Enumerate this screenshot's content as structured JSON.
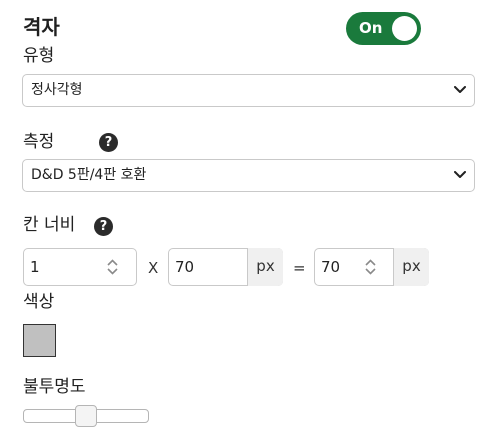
{
  "grid": {
    "title": "격자",
    "toggle_label": "On",
    "type_label": "유형",
    "type_value": "정사각형",
    "measure_label": "측정",
    "measure_help": "?",
    "measure_value": "D&D 5판/4판 호환",
    "cell_width_label": "칸 너비",
    "cell_width_help": "?",
    "cell_count_value": "1",
    "times_symbol": "X",
    "cell_px_value": "70",
    "cell_px_unit": "px",
    "equals_symbol": "=",
    "total_px_value": "70",
    "total_px_unit": "px",
    "color_label": "색상",
    "color_value": "#c0c0c0",
    "opacity_label": "불투명도",
    "opacity_fraction": 0.5
  },
  "colors": {
    "toggle_on": "#1a7a3c",
    "text": "#222222",
    "border": "#c9c9c9"
  },
  "icons": {
    "help": "help-icon",
    "select": "chevron-down-icon",
    "spinner": "spinner-icon"
  }
}
